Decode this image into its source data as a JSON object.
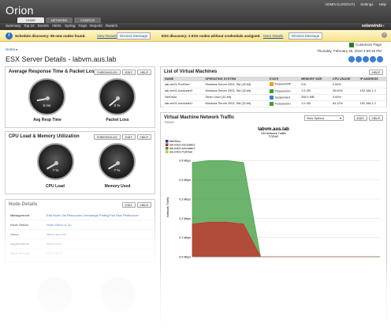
{
  "app": {
    "logo": "Orion",
    "admin_link": "ADMIN (LOGOUT)",
    "settings_link": "Settings",
    "help_link": "Help",
    "brand": "solarwinds"
  },
  "tabs": [
    {
      "label": "HOME"
    },
    {
      "label": "NETWORK"
    },
    {
      "label": "CONFIGS"
    }
  ],
  "menu": [
    "Summary",
    "Top 10",
    "Events",
    "Alerts",
    "Syslog",
    "Traps",
    "Reports",
    "Rwatch"
  ],
  "notifications": {
    "discovery_msg": "Schedule discovery: 55 new nodes found.",
    "view_results": "View Results",
    "dismiss1": "Dismiss Message",
    "esx_msg": "ESX discovery: 2 ESX nodes without credentials assigned.",
    "more_details": "More Details",
    "dismiss2": "Dismiss Message"
  },
  "breadcrumb": "Home",
  "customize": "Customize Page",
  "datetime": "Thursday, February 25, 2010 2:59:16 PM",
  "page_title": "ESX Server Details - labvm.aus.lab",
  "response_panel": {
    "title": "Average Response Time & Packet Loss",
    "buttons": [
      "THRESHOLDS",
      "EDIT",
      "HELP"
    ],
    "gauge1_value": "6 ms",
    "gauge1_label": "Avg Resp Time",
    "gauge2_value": "0 %",
    "gauge2_label": "Packet Loss"
  },
  "cpu_panel": {
    "title": "CPU Load & Memory Utilization",
    "buttons": [
      "THRESHOLDS",
      "EDIT",
      "HELP"
    ],
    "gauge1_value": "7 %",
    "gauge1_label": "CPU Load",
    "gauge2_value": "7 %",
    "gauge2_label": "Memory Used"
  },
  "node_panel": {
    "title": "Node Details",
    "buttons": [
      "EDIT",
      "HELP"
    ],
    "rows": [
      {
        "label": "Management",
        "value": "Edit Node   List Resources   Unmanage   Polling   Poll Now   Rediscover"
      },
      {
        "label": "Node Status",
        "value": "Node status is Up."
      },
      {
        "label": "Name",
        "value": "labvm.aus.lab"
      },
      {
        "label": "Applications",
        "value": "Resources"
      },
      {
        "label": "Node Groups",
        "value": "EDIT  HELP"
      }
    ]
  },
  "vm_panel": {
    "title": "List of Virtual Machines",
    "help": "HELP",
    "columns": [
      "NAME",
      "OPERATING SYSTEM",
      "STATE",
      "MEMORY SIZE",
      "CPU USAGE",
      "IP ADDRESS"
    ],
    "rows": [
      {
        "name": "lab-vm01-PortOwn",
        "os": "Windows Server 2003, Std (32-bit)",
        "state": "PoweredOff",
        "mem": "0 B",
        "cpu": "0.00%",
        "ip": ""
      },
      {
        "name": "lab-vm01-Icecluster2",
        "os": "Windows Server 2003, Std (32-bit)",
        "state": "PoweredOn",
        "mem": "1.0 GB",
        "cpu": "26.00%",
        "ip": "192.168.1.3"
      },
      {
        "name": "NetOrion",
        "os": "Other Linux (32-bit)",
        "state": "Suspended",
        "mem": "256.0 MB",
        "cpu": "0.00%",
        "ip": ""
      },
      {
        "name": "lab-vm01-Icecluster1",
        "os": "Windows Server 2003, Std (32-bit)",
        "state": "PoweredOn",
        "mem": "1.0 GB",
        "cpu": "64.12%",
        "ip": "192.168.1.2"
      }
    ]
  },
  "traffic_panel": {
    "title": "Virtual Machine Network Traffic",
    "subtitle": "TODAY",
    "view_options": "View Options",
    "buttons": [
      "EDIT",
      "HELP"
    ],
    "chart_title": "labvm.aus.lab",
    "chart_sub1": "VM Network Traffic",
    "chart_sub2": "TODAY"
  },
  "chart_data": {
    "type": "area",
    "title": "labvm.aus.lab",
    "subtitle": "VM Network Traffic TODAY",
    "ylabel": "Network Traffic",
    "yticks": [
      "0.5 Mbps",
      "0.4 Mbps",
      "0.3 Mbps",
      "0.2 Mbps",
      "0.1 Mbps",
      "0.0 Mbps"
    ],
    "legend": [
      "NetOrion",
      "lab-vm01-Icecluster2",
      "lab-vm01-Icecluster1",
      "lab-vm01-PortOwn"
    ],
    "colors": {
      "NetOrion": "#1f3fa8",
      "lab-vm01-Icecluster2": "#c8292a",
      "lab-vm01-Icecluster1": "#3b9a3b",
      "lab-vm01-PortOwn": "#d0c040"
    },
    "series": [
      {
        "name": "lab-vm01-Icecluster1",
        "values": [
          0.49,
          0.5,
          0.5,
          0.49,
          0.0,
          0.0,
          0.0,
          0.0,
          0.0,
          0.0,
          0.0,
          0.0
        ]
      },
      {
        "name": "lab-vm01-Icecluster2",
        "values": [
          0.17,
          0.18,
          0.18,
          0.17,
          0.0,
          0.0,
          0.0,
          0.0,
          0.0,
          0.0,
          0.0,
          0.0
        ]
      }
    ],
    "ylim": [
      0,
      0.55
    ]
  },
  "colors": {
    "accent": "#1f57a6",
    "header": "#3a3a3a",
    "notify_bg": "#f6e28e"
  }
}
